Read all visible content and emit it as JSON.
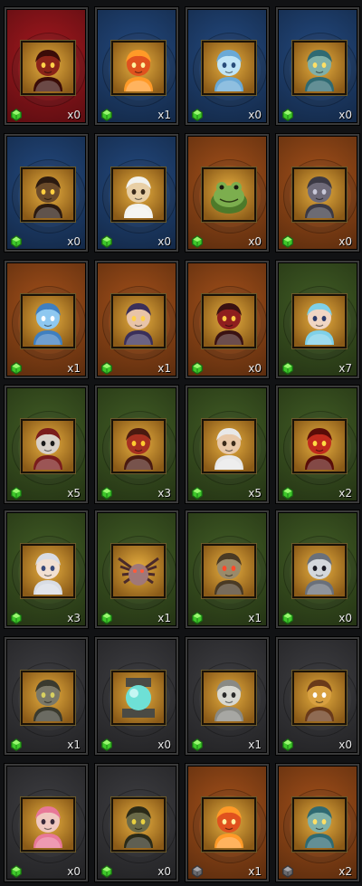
{
  "palette": {
    "red": "#a3181e",
    "blue": "#23497f",
    "orange": "#a4501a",
    "green": "#415d25",
    "gray": "#3e3e42"
  },
  "cards": [
    {
      "theme": "red",
      "portrait": "red-demon",
      "gem": "green",
      "count": "x0"
    },
    {
      "theme": "blue",
      "portrait": "fire-spirit",
      "gem": "green",
      "count": "x1"
    },
    {
      "theme": "blue",
      "portrait": "ice-spirit",
      "gem": "green",
      "count": "x0"
    },
    {
      "theme": "blue",
      "portrait": "cyan-goblin",
      "gem": "green",
      "count": "x0"
    },
    {
      "theme": "blue",
      "portrait": "boar-beast",
      "gem": "green",
      "count": "x0"
    },
    {
      "theme": "blue",
      "portrait": "old-sage",
      "gem": "green",
      "count": "x0"
    },
    {
      "theme": "orange",
      "portrait": "frog",
      "gem": "green",
      "count": "x0"
    },
    {
      "theme": "orange",
      "portrait": "stone-golem",
      "gem": "green",
      "count": "x0"
    },
    {
      "theme": "orange",
      "portrait": "crystal-spirit",
      "gem": "green",
      "count": "x1"
    },
    {
      "theme": "orange",
      "portrait": "witch",
      "gem": "green",
      "count": "x1"
    },
    {
      "theme": "orange",
      "portrait": "crimson-knight",
      "gem": "green",
      "count": "x0"
    },
    {
      "theme": "green",
      "portrait": "blue-haired-girl",
      "gem": "green",
      "count": "x7"
    },
    {
      "theme": "green",
      "portrait": "masked-warrior",
      "gem": "green",
      "count": "x5"
    },
    {
      "theme": "green",
      "portrait": "red-brute",
      "gem": "green",
      "count": "x3"
    },
    {
      "theme": "green",
      "portrait": "white-haired-monk",
      "gem": "green",
      "count": "x5"
    },
    {
      "theme": "green",
      "portrait": "red-imp",
      "gem": "green",
      "count": "x2"
    },
    {
      "theme": "green",
      "portrait": "silver-haired-heroine",
      "gem": "green",
      "count": "x3"
    },
    {
      "theme": "green",
      "portrait": "spider",
      "gem": "green",
      "count": "x1"
    },
    {
      "theme": "green",
      "portrait": "armored-knight",
      "gem": "green",
      "count": "x1"
    },
    {
      "theme": "green",
      "portrait": "white-ghoul",
      "gem": "green",
      "count": "x0"
    },
    {
      "theme": "gray",
      "portrait": "gargoyle",
      "gem": "green",
      "count": "x1"
    },
    {
      "theme": "gray",
      "portrait": "crystal-orb",
      "gem": "green",
      "count": "x0"
    },
    {
      "theme": "gray",
      "portrait": "white-warrior",
      "gem": "green",
      "count": "x1"
    },
    {
      "theme": "gray",
      "portrait": "golden-pharaoh",
      "gem": "green",
      "count": "x0"
    },
    {
      "theme": "gray",
      "portrait": "pink-haired-girl",
      "gem": "green",
      "count": "x0"
    },
    {
      "theme": "gray",
      "portrait": "dark-dragon",
      "gem": "green",
      "count": "x0"
    },
    {
      "theme": "orange",
      "portrait": "fire-spirit",
      "gem": "gray",
      "count": "x1"
    },
    {
      "theme": "orange",
      "portrait": "cyan-goblin",
      "gem": "gray",
      "count": "x2"
    }
  ]
}
